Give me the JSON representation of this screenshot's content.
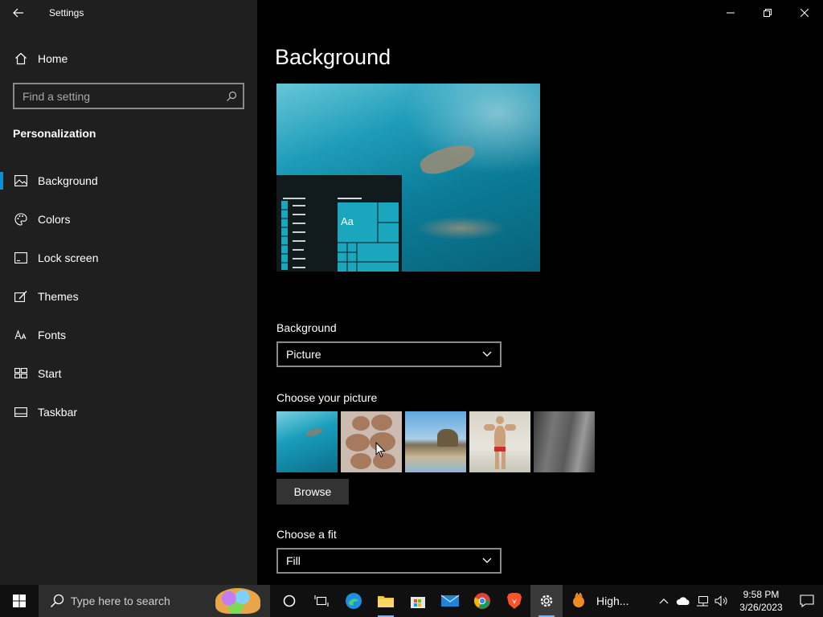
{
  "window": {
    "title": "Settings"
  },
  "sidebar": {
    "home_label": "Home",
    "search_placeholder": "Find a setting",
    "section_title": "Personalization",
    "items": [
      {
        "label": "Background",
        "icon": "picture-icon",
        "active": true
      },
      {
        "label": "Colors",
        "icon": "palette-icon",
        "active": false
      },
      {
        "label": "Lock screen",
        "icon": "lock-screen-icon",
        "active": false
      },
      {
        "label": "Themes",
        "icon": "themes-icon",
        "active": false
      },
      {
        "label": "Fonts",
        "icon": "fonts-icon",
        "active": false
      },
      {
        "label": "Start",
        "icon": "start-icon",
        "active": false
      },
      {
        "label": "Taskbar",
        "icon": "taskbar-icon",
        "active": false
      }
    ]
  },
  "main": {
    "page_title": "Background",
    "preview_tile_text": "Aa",
    "background_label": "Background",
    "background_value": "Picture",
    "choose_picture_label": "Choose your picture",
    "browse_label": "Browse",
    "fit_label": "Choose a fit",
    "fit_value": "Fill",
    "thumbnails": [
      "underwater-swimmer",
      "muscle-pile",
      "beach-rocks",
      "bodybuilder",
      "rock-face"
    ]
  },
  "taskbar": {
    "search_placeholder": "Type here to search",
    "active_app_label": "High...",
    "time": "9:58 PM",
    "date": "3/26/2023"
  },
  "colors": {
    "accent": "#0f8fd3",
    "sidebar_bg": "#1f1f1f",
    "main_bg": "#000000",
    "taskbar_bg": "#101010"
  }
}
